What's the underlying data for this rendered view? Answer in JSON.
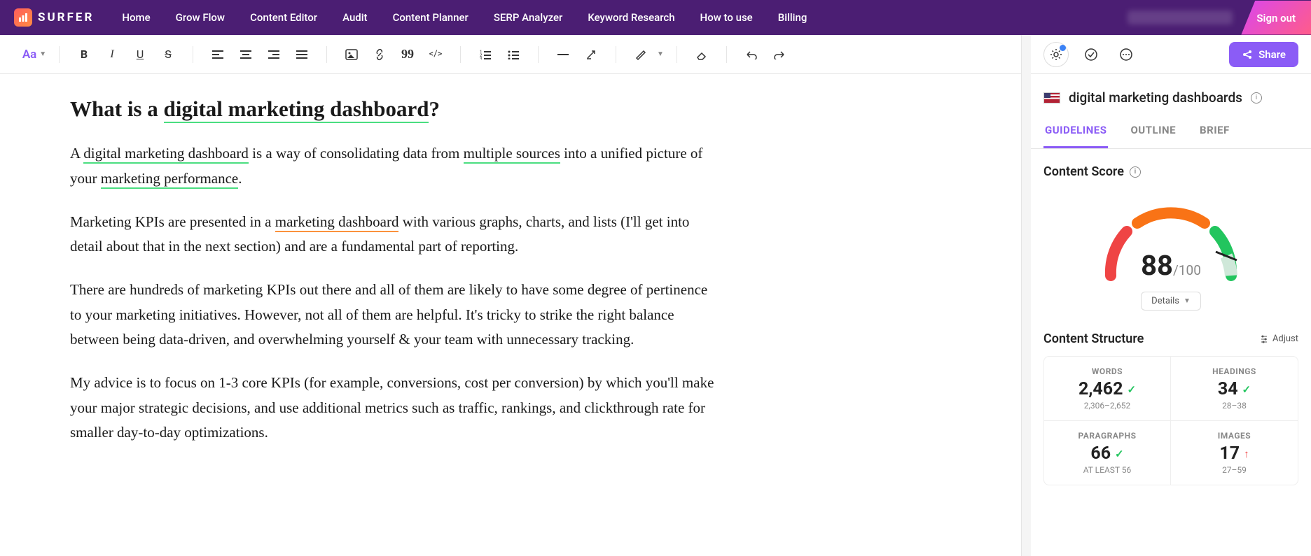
{
  "nav": {
    "brand": "SURFER",
    "items": [
      "Home",
      "Grow Flow",
      "Content Editor",
      "Audit",
      "Content Planner",
      "SERP Analyzer",
      "Keyword Research",
      "How to use",
      "Billing"
    ],
    "signout": "Sign out"
  },
  "toolbar": {
    "aa": "Aa"
  },
  "document": {
    "heading_pre": "What is a ",
    "heading_hl": "digital marketing dashboard",
    "heading_post": "?",
    "p1_a": "A ",
    "p1_hl1": "digital marketing dashboard",
    "p1_b": " is a way of consolidating data from ",
    "p1_hl2": "multiple sources",
    "p1_c": " into a unified picture of your ",
    "p1_hl3": "marketing performance",
    "p1_d": ".",
    "p2_a": "Marketing KPIs are presented in a ",
    "p2_hl1": "marketing dashboard",
    "p2_b": " with various graphs, charts, and lists (I'll get into detail about that in the next section) and are a fundamental part of reporting.",
    "p3": "There are hundreds of marketing KPIs out there and all of them are likely to have some degree of pertinence to your marketing initiatives. However, not all of them are helpful. It's tricky to strike the right balance between being data-driven, and overwhelming yourself & your team with unnecessary tracking.",
    "p4": "My advice is to focus on 1-3 core KPIs (for example, conversions, cost per conversion) by which you'll make your major strategic decisions, and use additional metrics such as traffic, rankings, and clickthrough rate for smaller day-to-day optimizations."
  },
  "sidebar": {
    "keyword": "digital marketing dashboards",
    "tabs": {
      "guidelines": "GUIDELINES",
      "outline": "OUTLINE",
      "brief": "BRIEF"
    },
    "share": "Share",
    "score_label": "Content Score",
    "score": "88",
    "score_max": "/100",
    "details": "Details",
    "structure_label": "Content Structure",
    "adjust": "Adjust",
    "metrics": {
      "words": {
        "label": "WORDS",
        "value": "2,462",
        "range": "2,306–2,652",
        "status": "ok"
      },
      "headings": {
        "label": "HEADINGS",
        "value": "34",
        "range": "28–38",
        "status": "ok"
      },
      "paragraphs": {
        "label": "PARAGRAPHS",
        "value": "66",
        "range": "AT LEAST 56",
        "status": "ok"
      },
      "images": {
        "label": "IMAGES",
        "value": "17",
        "range": "27–59",
        "status": "low"
      }
    }
  }
}
